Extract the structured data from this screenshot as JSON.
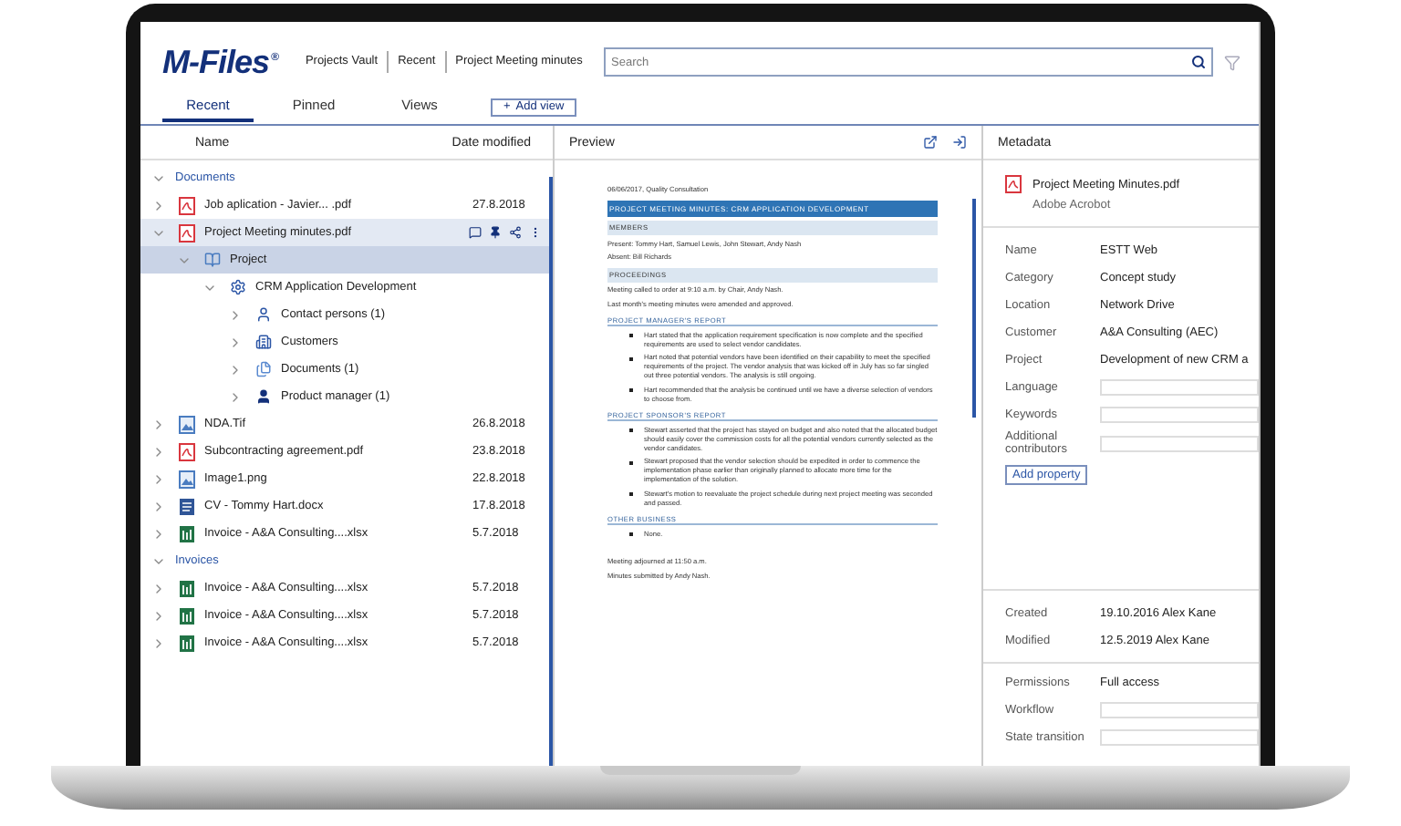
{
  "header": {
    "logo": "M-Files",
    "logo_mark": "®",
    "breadcrumbs": [
      "Projects Vault",
      "Recent",
      "Project Meeting minutes"
    ],
    "search": {
      "placeholder": "Search"
    }
  },
  "tabs": [
    {
      "label": "Recent",
      "selected": true
    },
    {
      "label": "Pinned",
      "selected": false
    },
    {
      "label": "Views",
      "selected": false
    }
  ],
  "add_view": {
    "icon": "+",
    "label": "Add view"
  },
  "list": {
    "columns": [
      "Name",
      "Date modified"
    ],
    "groups": [
      {
        "title": "Documents",
        "expanded": true,
        "items": [
          {
            "name": "Job aplication - Javier... .pdf",
            "date": "27.8.2018",
            "kind": "pdf",
            "expanded": false,
            "selected": false
          },
          {
            "name": "Project Meeting minutes.pdf",
            "kind": "pdf",
            "expanded": true,
            "selected": true,
            "children": [
              {
                "name": "Project",
                "kind": "book",
                "expanded": true,
                "selected": true,
                "children": [
                  {
                    "name": "CRM Application Development",
                    "kind": "gear",
                    "expanded": true,
                    "selected": false,
                    "children": [
                      {
                        "name": "Contact persons (1)",
                        "kind": "person",
                        "expanded": false,
                        "selected": false
                      },
                      {
                        "name": "Customers",
                        "kind": "building",
                        "expanded": false,
                        "selected": false
                      },
                      {
                        "name": "Documents (1)",
                        "kind": "docs",
                        "expanded": false,
                        "selected": false
                      },
                      {
                        "name": "Product manager (1)",
                        "kind": "manager",
                        "expanded": false,
                        "selected": false
                      }
                    ]
                  }
                ]
              }
            ]
          },
          {
            "name": "NDA.Tif",
            "date": "26.8.2018",
            "kind": "image",
            "expanded": false,
            "selected": false
          },
          {
            "name": "Subcontracting agreement.pdf",
            "date": "23.8.2018",
            "kind": "pdf",
            "expanded": false,
            "selected": false
          },
          {
            "name": "Image1.png",
            "date": "22.8.2018",
            "kind": "image",
            "expanded": false,
            "selected": false
          },
          {
            "name": "CV - Tommy Hart.docx",
            "date": "17.8.2018",
            "kind": "word",
            "expanded": false,
            "selected": false
          },
          {
            "name": "Invoice - A&A Consulting....xlsx",
            "date": "5.7.2018",
            "kind": "excel",
            "expanded": false,
            "selected": false
          }
        ]
      },
      {
        "title": "Invoices",
        "expanded": true,
        "items": [
          {
            "name": "Invoice - A&A Consulting....xlsx",
            "date": "5.7.2018",
            "kind": "excel",
            "expanded": false,
            "selected": false
          },
          {
            "name": "Invoice - A&A Consulting....xlsx",
            "date": "5.7.2018",
            "kind": "excel",
            "expanded": false,
            "selected": false
          },
          {
            "name": "Invoice - A&A Consulting....xlsx",
            "date": "5.7.2018",
            "kind": "excel",
            "expanded": false,
            "selected": false
          }
        ]
      }
    ]
  },
  "preview": {
    "title": "Preview",
    "document": [
      {
        "kind": "line",
        "text": "06/06/2017, Quality Consultation"
      },
      {
        "kind": "title",
        "text": "PROJECT MEETING MINUTES: CRM APPLICATION DEVELOPMENT"
      },
      {
        "kind": "band",
        "text": "MEMBERS"
      },
      {
        "kind": "line",
        "text": "Present: Tommy Hart, Samuel Lewis, John Stewart, Andy Nash"
      },
      {
        "kind": "line",
        "text": "Absent: Bill Richards"
      },
      {
        "kind": "band",
        "text": "PROCEEDINGS"
      },
      {
        "kind": "line",
        "text": "Meeting called to order at 9:10 a.m. by Chair, Andy Nash."
      },
      {
        "kind": "line",
        "text": "Last month's meeting minutes were amended and approved."
      },
      {
        "kind": "rule",
        "text": "PROJECT MANAGER'S REPORT"
      },
      {
        "kind": "bullet",
        "text": "Hart stated that the application requirement specification is now complete and the specified requirements are used to select vendor candidates."
      },
      {
        "kind": "bullet",
        "text": "Hart noted that potential vendors have been identified on their capability to meet the specified requirements of the project. The vendor analysis that was kicked off in July has so far singled out three potential vendors. The analysis is still ongoing."
      },
      {
        "kind": "bullet",
        "text": "Hart recommended that the analysis be continued until we have a diverse selection of vendors to choose from."
      },
      {
        "kind": "rule",
        "text": "PROJECT SPONSOR'S REPORT"
      },
      {
        "kind": "bullet",
        "text": "Stewart asserted that the project has stayed on budget and also noted that the allocated budget should easily cover the commission costs for all the potential vendors currently selected as the vendor candidates."
      },
      {
        "kind": "bullet",
        "text": "Stewart proposed that the vendor selection should be expedited in order to commence the implementation phase earlier than originally planned to allocate more time for the implementation of the solution."
      },
      {
        "kind": "bullet",
        "text": "Stewart's motion to reevaluate the project schedule during next project meeting was seconded and passed."
      },
      {
        "kind": "rule",
        "text": "OTHER BUSINESS"
      },
      {
        "kind": "bullet",
        "text": "None."
      },
      {
        "kind": "gap",
        "text": "Meeting adjourned at 11:50 a.m."
      },
      {
        "kind": "line",
        "text": "Minutes submitted by Andy Nash."
      }
    ]
  },
  "metadata": {
    "title": "Metadata",
    "file": {
      "name": "Project Meeting Minutes.pdf",
      "app": "Adobe Acrobot"
    },
    "properties": [
      {
        "kind": "text",
        "label": "Name",
        "value": "ESTT Web"
      },
      {
        "kind": "text",
        "label": "Category",
        "value": "Concept study"
      },
      {
        "kind": "text",
        "label": "Location",
        "value": "Network Drive"
      },
      {
        "kind": "text",
        "label": "Customer",
        "value": "A&A Consulting (AEC)"
      },
      {
        "kind": "text",
        "label": "Project",
        "value": "Development of new CRM a"
      },
      {
        "kind": "input",
        "label": "Language"
      },
      {
        "kind": "input",
        "label": "Keywords"
      },
      {
        "kind": "input",
        "label": "Additional contributors"
      }
    ],
    "add_property": "Add property",
    "dates": [
      {
        "kind": "text",
        "label": "Created",
        "value": "19.10.2016 Alex Kane"
      },
      {
        "kind": "text",
        "label": "Modified",
        "value": "12.5.2019 Alex Kane"
      }
    ],
    "workflow": [
      {
        "kind": "text",
        "label": "Permissions",
        "value": "Full access"
      },
      {
        "kind": "input",
        "label": "Workflow"
      },
      {
        "kind": "input",
        "label": "State transition"
      }
    ]
  }
}
